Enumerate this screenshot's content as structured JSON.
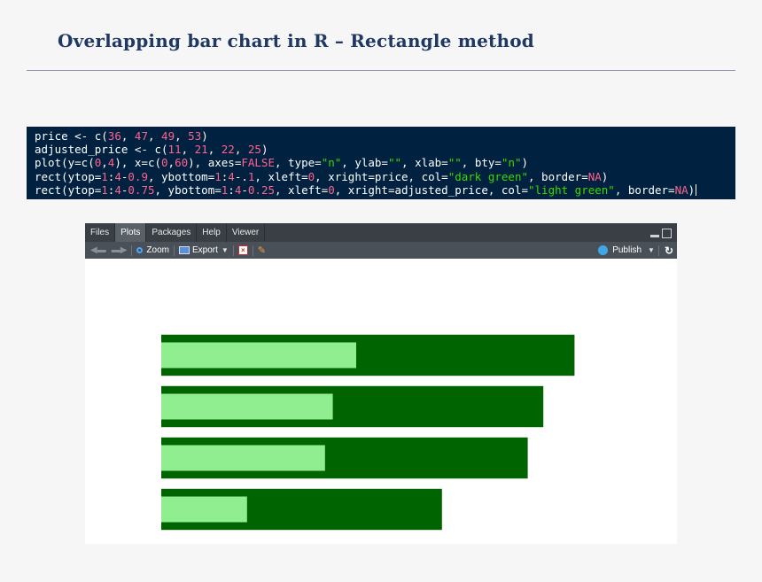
{
  "slide": {
    "title": "Overlapping bar chart in R – Rectangle method"
  },
  "code_lines": [
    [
      {
        "t": "price <- c("
      },
      {
        "t": "36",
        "c": "num"
      },
      {
        "t": ", "
      },
      {
        "t": "47",
        "c": "num"
      },
      {
        "t": ", "
      },
      {
        "t": "49",
        "c": "num"
      },
      {
        "t": ", "
      },
      {
        "t": "53",
        "c": "num"
      },
      {
        "t": ")"
      }
    ],
    [
      {
        "t": "adjusted_price <- c("
      },
      {
        "t": "11",
        "c": "num"
      },
      {
        "t": ", "
      },
      {
        "t": "21",
        "c": "num"
      },
      {
        "t": ", "
      },
      {
        "t": "22",
        "c": "num"
      },
      {
        "t": ", "
      },
      {
        "t": "25",
        "c": "num"
      },
      {
        "t": ")"
      }
    ],
    [
      {
        "t": "plot(y=c("
      },
      {
        "t": "0",
        "c": "num"
      },
      {
        "t": ","
      },
      {
        "t": "4",
        "c": "num"
      },
      {
        "t": "), x=c("
      },
      {
        "t": "0",
        "c": "num"
      },
      {
        "t": ","
      },
      {
        "t": "60",
        "c": "num"
      },
      {
        "t": "), axes="
      },
      {
        "t": "FALSE",
        "c": "kw"
      },
      {
        "t": ", type="
      },
      {
        "t": "\"n\"",
        "c": "str"
      },
      {
        "t": ", ylab="
      },
      {
        "t": "\"\"",
        "c": "str"
      },
      {
        "t": ", xlab="
      },
      {
        "t": "\"\"",
        "c": "str"
      },
      {
        "t": ", bty="
      },
      {
        "t": "\"n\"",
        "c": "str"
      },
      {
        "t": ")"
      }
    ],
    [
      {
        "t": "rect(ytop="
      },
      {
        "t": "1",
        "c": "num"
      },
      {
        "t": ":"
      },
      {
        "t": "4",
        "c": "num"
      },
      {
        "t": "-"
      },
      {
        "t": "0.9",
        "c": "num"
      },
      {
        "t": ", ybottom="
      },
      {
        "t": "1",
        "c": "num"
      },
      {
        "t": ":"
      },
      {
        "t": "4",
        "c": "num"
      },
      {
        "t": "-."
      },
      {
        "t": "1",
        "c": "num"
      },
      {
        "t": ", xleft="
      },
      {
        "t": "0",
        "c": "num"
      },
      {
        "t": ", xright=price, col="
      },
      {
        "t": "\"dark green\"",
        "c": "str"
      },
      {
        "t": ", border="
      },
      {
        "t": "NA",
        "c": "kw"
      },
      {
        "t": ")"
      }
    ],
    [
      {
        "t": "rect(ytop="
      },
      {
        "t": "1",
        "c": "num"
      },
      {
        "t": ":"
      },
      {
        "t": "4",
        "c": "num"
      },
      {
        "t": "-"
      },
      {
        "t": "0.75",
        "c": "num"
      },
      {
        "t": ", ybottom="
      },
      {
        "t": "1",
        "c": "num"
      },
      {
        "t": ":"
      },
      {
        "t": "4",
        "c": "num"
      },
      {
        "t": "-"
      },
      {
        "t": "0.25",
        "c": "num"
      },
      {
        "t": ", xleft="
      },
      {
        "t": "0",
        "c": "num"
      },
      {
        "t": ", xright=adjusted_price, col="
      },
      {
        "t": "\"light green\"",
        "c": "str"
      },
      {
        "t": ", border="
      },
      {
        "t": "NA",
        "c": "kw"
      },
      {
        "t": ")"
      }
    ]
  ],
  "panel": {
    "tabs": [
      "Files",
      "Plots",
      "Packages",
      "Help",
      "Viewer"
    ],
    "active_tab": "Plots",
    "toolbar": {
      "zoom_label": "Zoom",
      "export_label": "Export",
      "publish_label": "Publish"
    }
  },
  "colors": {
    "dark_green": "#006400",
    "light_green": "#90ee90",
    "code_bg": "#002240",
    "title": "#1f3864"
  },
  "chart_data": {
    "type": "bar",
    "x_range": [
      0,
      60
    ],
    "y_range": [
      0,
      4
    ],
    "axes": false,
    "series": [
      {
        "values": [
          36,
          47,
          49,
          53
        ],
        "color": "#006400"
      },
      {
        "values": [
          11,
          21,
          22,
          25
        ],
        "color": "#90ee90"
      }
    ]
  }
}
